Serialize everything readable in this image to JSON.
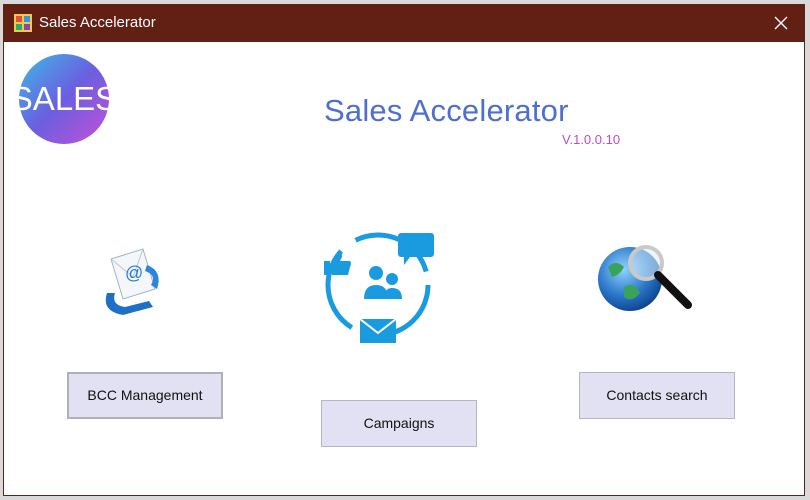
{
  "window": {
    "title": "Sales Accelerator",
    "icons": {
      "app": "app-icon",
      "close": "close-icon"
    }
  },
  "header": {
    "logo_text": "SALES",
    "title": "Sales Accelerator",
    "version": "V.1.0.0.10"
  },
  "actions": [
    {
      "label": "BCC Management",
      "icon": "email-icon"
    },
    {
      "label": "Campaigns",
      "icon": "campaign-icon"
    },
    {
      "label": "Contacts search",
      "icon": "globe-search-icon"
    }
  ],
  "colors": {
    "titlebar": "#621f13",
    "title_text": "#4f6fd0",
    "version_text": "#b84fc4",
    "button_bg": "#e1e1f3",
    "icon_blue": "#1a9be0"
  }
}
